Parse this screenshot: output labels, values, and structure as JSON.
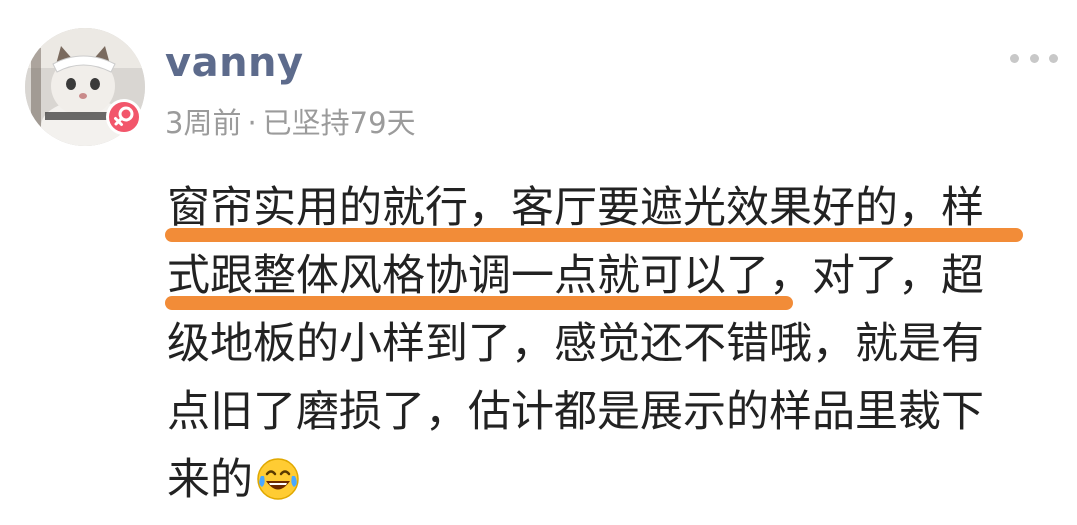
{
  "post": {
    "author": {
      "username": "vanny",
      "avatar_icon": "cat-avatar-icon",
      "gender_icon": "female-icon",
      "gender_color": "#f2566b"
    },
    "meta": {
      "time_ago": "3周前",
      "separator": "·",
      "streak": "已坚持79天"
    },
    "more_icon": "more-dots-icon",
    "content_lines": [
      "窗帘实用的就行，客厅要遮光效果好的，样",
      "式跟整体风格协调一点就可以了，对了，超",
      "级地板的小样到了，感觉还不错哦，就是有",
      "点旧了磨损了，估计都是展示的样品里裁下",
      "来的"
    ],
    "emoji_icon": "laughing-tears-emoji-icon",
    "highlight_color": "#f28c38"
  }
}
